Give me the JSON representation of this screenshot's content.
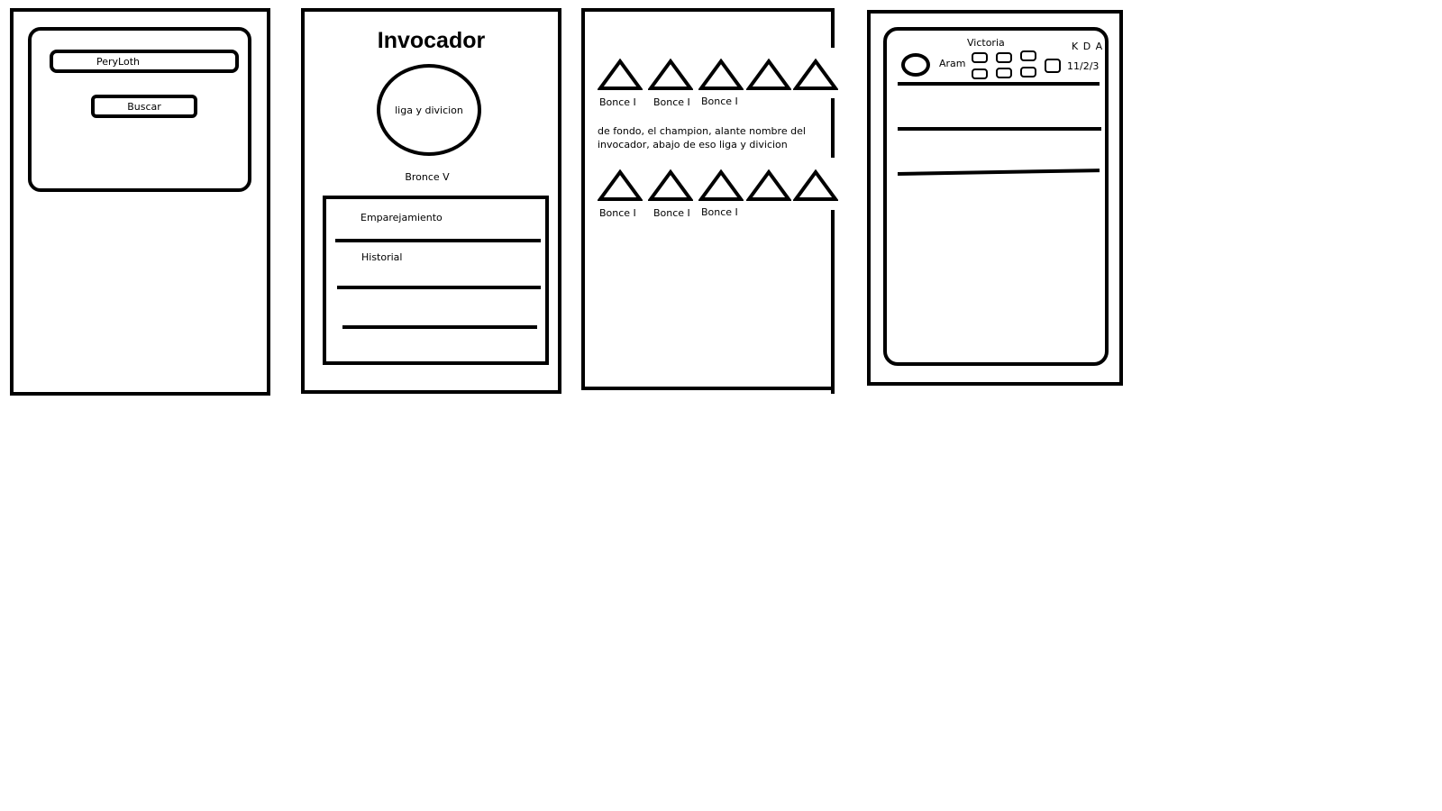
{
  "screen1": {
    "search_value": "PeryLoth",
    "search_button": "Buscar"
  },
  "screen2": {
    "title": "Invocador",
    "avatar_label": "liga y divicion",
    "rank": "Bronce V",
    "menu_items": [
      "Emparejamiento",
      "Historial"
    ]
  },
  "screen3": {
    "top_row_labels": [
      "Bonce I",
      "Bonce I",
      "Bonce I"
    ],
    "note": "de fondo, el champion, alante nombre del invocador, abajo de eso liga y divicion",
    "note_line1": "de fondo, el champion, alante nombre del",
    "note_line2": "invocador, abajo de eso liga y divicion",
    "bottom_row_labels": [
      "Bonce I",
      "Bonce I",
      "Bonce I"
    ]
  },
  "screen4": {
    "result": "Victoria",
    "mode": "Aram",
    "kda_label": "K D A",
    "kda_value": "11/2/3"
  }
}
